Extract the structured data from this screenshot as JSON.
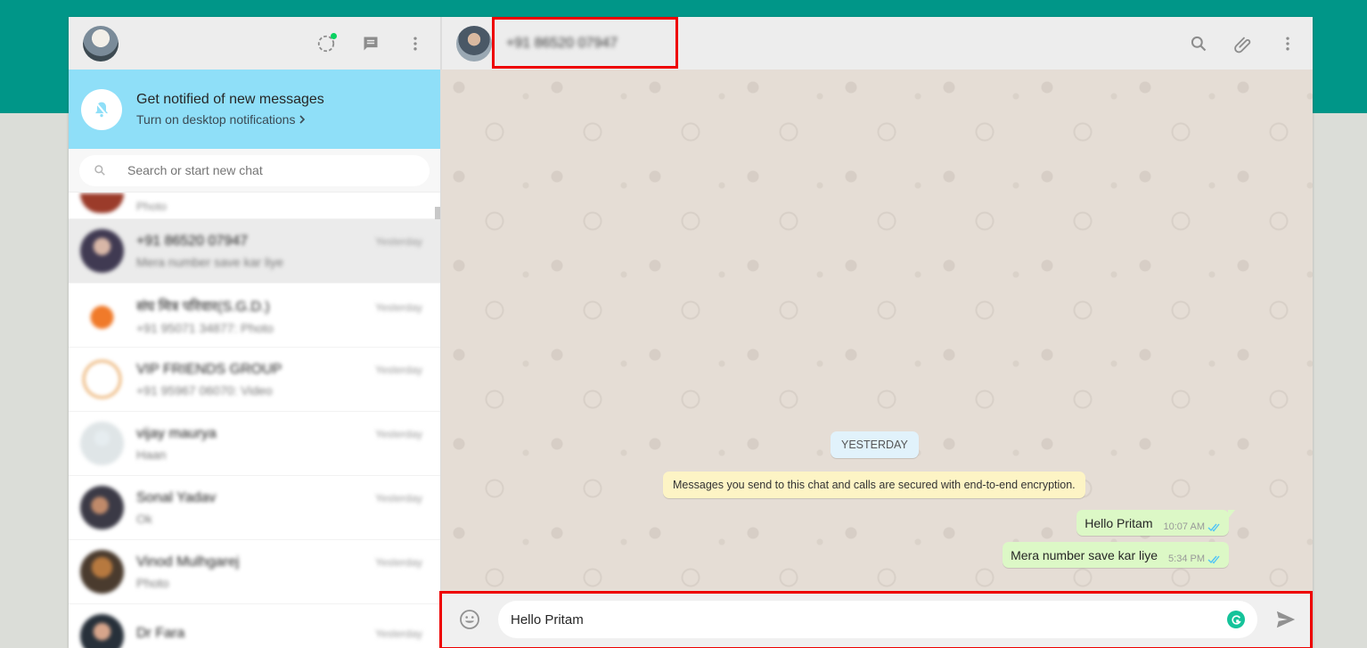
{
  "colors": {
    "accent": "#009688",
    "notif_bg": "#8fdff8",
    "outgoing_bubble": "#dcf8c6",
    "highlight_box": "#ee0000"
  },
  "notification": {
    "title": "Get notified of new messages",
    "link": "Turn on desktop notifications"
  },
  "search": {
    "placeholder": "Search or start new chat"
  },
  "sidebar_icons": [
    "status-icon",
    "new-chat-icon",
    "menu-icon"
  ],
  "chat_list": [
    {
      "name": "",
      "last": "Photo",
      "time": ""
    },
    {
      "name": "+91 86520 07947",
      "last": "Mera number save kar liye",
      "time": "Yesterday"
    },
    {
      "name": "संघ मित्र परिवार(S.G.D.)",
      "last": "+91 95071 34877: Photo",
      "time": "Yesterday"
    },
    {
      "name": "VIP FRIENDS GROUP",
      "last": "+91 95967 06070: Video",
      "time": "Yesterday"
    },
    {
      "name": "vijay maurya",
      "last": "Haan",
      "time": "Yesterday"
    },
    {
      "name": "Sonal Yadav",
      "last": "Ok",
      "time": "Yesterday"
    },
    {
      "name": "Vinod Mulhgarej",
      "last": "Photo",
      "time": "Yesterday"
    },
    {
      "name": "Dr Fara",
      "last": "",
      "time": "Yesterday"
    }
  ],
  "conversation": {
    "contact_name": "+91 86520 07947",
    "header_icons": [
      "search-icon",
      "attach-icon",
      "menu-icon"
    ],
    "date_label": "YESTERDAY",
    "encryption_notice": "Messages you send to this chat and calls are secured with end-to-end encryption.",
    "messages": [
      {
        "text": "Hello Pritam",
        "time": "10:07 AM",
        "status": "read"
      },
      {
        "text": "Mera number save kar liye",
        "time": "5:34 PM",
        "status": "read"
      }
    ]
  },
  "composer": {
    "value": "Hello Pritam"
  }
}
